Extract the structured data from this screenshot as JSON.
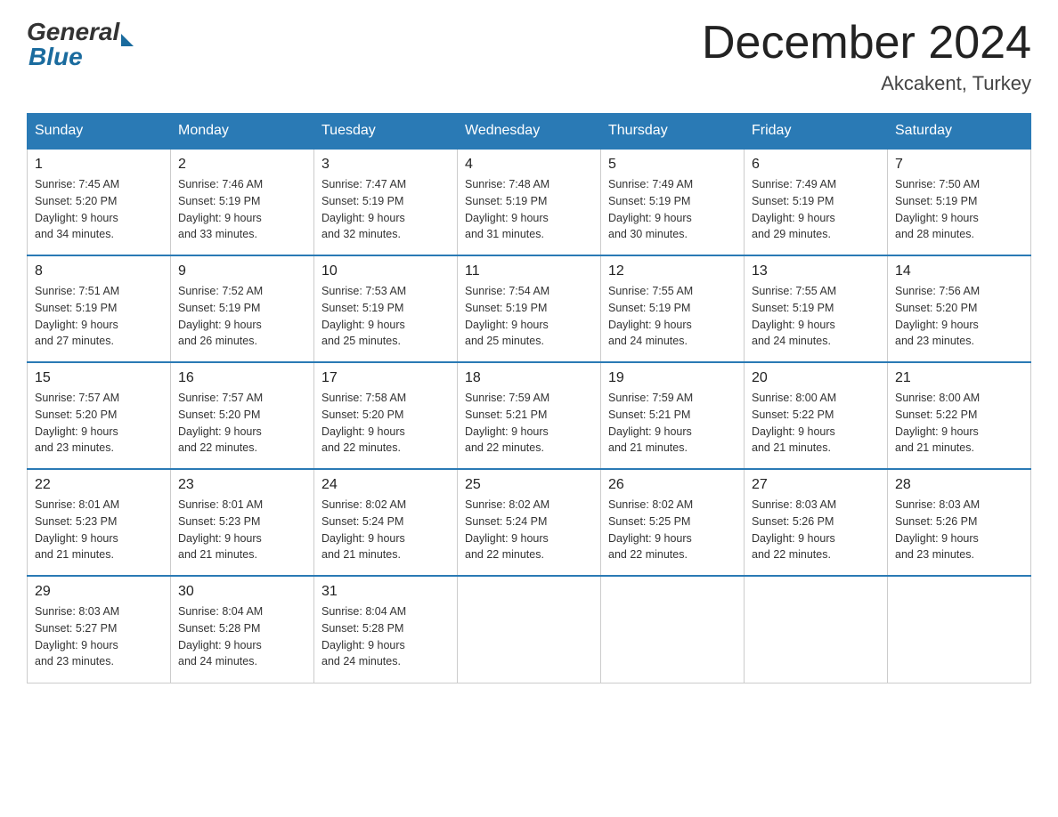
{
  "header": {
    "logo_general": "General",
    "logo_blue": "Blue",
    "month_title": "December 2024",
    "location": "Akcakent, Turkey"
  },
  "days_of_week": [
    "Sunday",
    "Monday",
    "Tuesday",
    "Wednesday",
    "Thursday",
    "Friday",
    "Saturday"
  ],
  "weeks": [
    [
      {
        "day": "1",
        "sunrise": "7:45 AM",
        "sunset": "5:20 PM",
        "daylight": "9 hours and 34 minutes."
      },
      {
        "day": "2",
        "sunrise": "7:46 AM",
        "sunset": "5:19 PM",
        "daylight": "9 hours and 33 minutes."
      },
      {
        "day": "3",
        "sunrise": "7:47 AM",
        "sunset": "5:19 PM",
        "daylight": "9 hours and 32 minutes."
      },
      {
        "day": "4",
        "sunrise": "7:48 AM",
        "sunset": "5:19 PM",
        "daylight": "9 hours and 31 minutes."
      },
      {
        "day": "5",
        "sunrise": "7:49 AM",
        "sunset": "5:19 PM",
        "daylight": "9 hours and 30 minutes."
      },
      {
        "day": "6",
        "sunrise": "7:49 AM",
        "sunset": "5:19 PM",
        "daylight": "9 hours and 29 minutes."
      },
      {
        "day": "7",
        "sunrise": "7:50 AM",
        "sunset": "5:19 PM",
        "daylight": "9 hours and 28 minutes."
      }
    ],
    [
      {
        "day": "8",
        "sunrise": "7:51 AM",
        "sunset": "5:19 PM",
        "daylight": "9 hours and 27 minutes."
      },
      {
        "day": "9",
        "sunrise": "7:52 AM",
        "sunset": "5:19 PM",
        "daylight": "9 hours and 26 minutes."
      },
      {
        "day": "10",
        "sunrise": "7:53 AM",
        "sunset": "5:19 PM",
        "daylight": "9 hours and 25 minutes."
      },
      {
        "day": "11",
        "sunrise": "7:54 AM",
        "sunset": "5:19 PM",
        "daylight": "9 hours and 25 minutes."
      },
      {
        "day": "12",
        "sunrise": "7:55 AM",
        "sunset": "5:19 PM",
        "daylight": "9 hours and 24 minutes."
      },
      {
        "day": "13",
        "sunrise": "7:55 AM",
        "sunset": "5:19 PM",
        "daylight": "9 hours and 24 minutes."
      },
      {
        "day": "14",
        "sunrise": "7:56 AM",
        "sunset": "5:20 PM",
        "daylight": "9 hours and 23 minutes."
      }
    ],
    [
      {
        "day": "15",
        "sunrise": "7:57 AM",
        "sunset": "5:20 PM",
        "daylight": "9 hours and 23 minutes."
      },
      {
        "day": "16",
        "sunrise": "7:57 AM",
        "sunset": "5:20 PM",
        "daylight": "9 hours and 22 minutes."
      },
      {
        "day": "17",
        "sunrise": "7:58 AM",
        "sunset": "5:20 PM",
        "daylight": "9 hours and 22 minutes."
      },
      {
        "day": "18",
        "sunrise": "7:59 AM",
        "sunset": "5:21 PM",
        "daylight": "9 hours and 22 minutes."
      },
      {
        "day": "19",
        "sunrise": "7:59 AM",
        "sunset": "5:21 PM",
        "daylight": "9 hours and 21 minutes."
      },
      {
        "day": "20",
        "sunrise": "8:00 AM",
        "sunset": "5:22 PM",
        "daylight": "9 hours and 21 minutes."
      },
      {
        "day": "21",
        "sunrise": "8:00 AM",
        "sunset": "5:22 PM",
        "daylight": "9 hours and 21 minutes."
      }
    ],
    [
      {
        "day": "22",
        "sunrise": "8:01 AM",
        "sunset": "5:23 PM",
        "daylight": "9 hours and 21 minutes."
      },
      {
        "day": "23",
        "sunrise": "8:01 AM",
        "sunset": "5:23 PM",
        "daylight": "9 hours and 21 minutes."
      },
      {
        "day": "24",
        "sunrise": "8:02 AM",
        "sunset": "5:24 PM",
        "daylight": "9 hours and 21 minutes."
      },
      {
        "day": "25",
        "sunrise": "8:02 AM",
        "sunset": "5:24 PM",
        "daylight": "9 hours and 22 minutes."
      },
      {
        "day": "26",
        "sunrise": "8:02 AM",
        "sunset": "5:25 PM",
        "daylight": "9 hours and 22 minutes."
      },
      {
        "day": "27",
        "sunrise": "8:03 AM",
        "sunset": "5:26 PM",
        "daylight": "9 hours and 22 minutes."
      },
      {
        "day": "28",
        "sunrise": "8:03 AM",
        "sunset": "5:26 PM",
        "daylight": "9 hours and 23 minutes."
      }
    ],
    [
      {
        "day": "29",
        "sunrise": "8:03 AM",
        "sunset": "5:27 PM",
        "daylight": "9 hours and 23 minutes."
      },
      {
        "day": "30",
        "sunrise": "8:04 AM",
        "sunset": "5:28 PM",
        "daylight": "9 hours and 24 minutes."
      },
      {
        "day": "31",
        "sunrise": "8:04 AM",
        "sunset": "5:28 PM",
        "daylight": "9 hours and 24 minutes."
      },
      null,
      null,
      null,
      null
    ]
  ],
  "labels": {
    "sunrise": "Sunrise:",
    "sunset": "Sunset:",
    "daylight": "Daylight:"
  }
}
